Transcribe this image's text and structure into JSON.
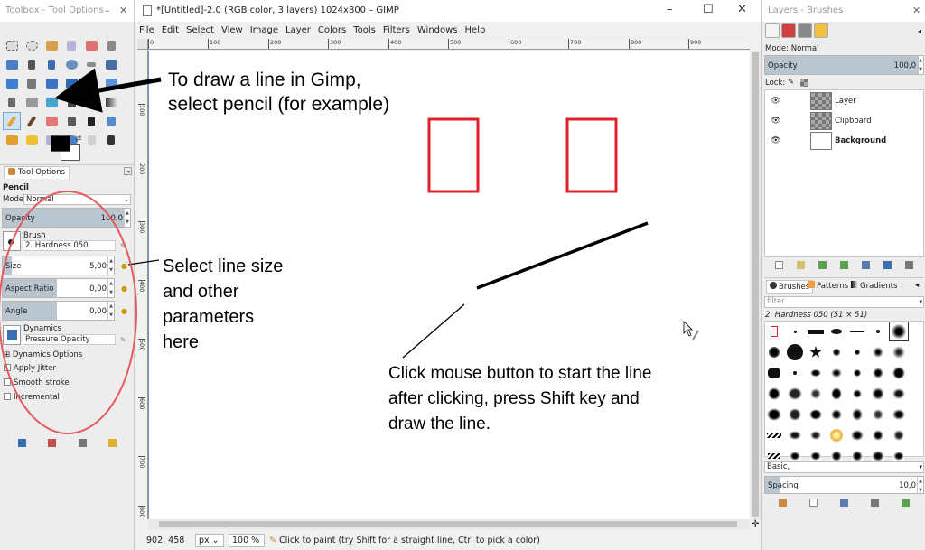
{
  "toolbox": {
    "title": "Toolbox - Tool Options",
    "tool_options_tab": "Tool Options",
    "tool_name": "Pencil",
    "mode_label": "Mode:",
    "mode_value": "Normal",
    "opacity_label": "Opacity",
    "opacity_value": "100,0",
    "brush_label": "Brush",
    "brush_value": "2. Hardness 050",
    "size_label": "Size",
    "size_value": "5,00",
    "aspect_label": "Aspect Ratio",
    "aspect_value": "0,00",
    "angle_label": "Angle",
    "angle_value": "0,00",
    "dynamics_label": "Dynamics",
    "dynamics_value": "Pressure Opacity",
    "dynamics_options": "Dynamics Options",
    "apply_jitter": "Apply Jitter",
    "smooth_stroke": "Smooth stroke",
    "incremental": "Incremental"
  },
  "image_window": {
    "title": "*[Untitled]-2.0 (RGB color, 3 layers) 1024x800 – GIMP",
    "menu": [
      "File",
      "Edit",
      "Select",
      "View",
      "Image",
      "Layer",
      "Colors",
      "Tools",
      "Filters",
      "Windows",
      "Help"
    ],
    "ruler_h": [
      "0",
      "100",
      "200",
      "300",
      "400",
      "500",
      "600",
      "700",
      "800",
      "900"
    ],
    "ruler_v": [
      "100",
      "200",
      "300",
      "400",
      "500",
      "600",
      "700",
      "800"
    ],
    "coords": "902, 458",
    "unit": "px",
    "zoom": "100 %",
    "status_message": "Click to paint (try Shift for a straight line, Ctrl to pick a color)"
  },
  "dock": {
    "title": "Layers - Brushes",
    "mode_label": "Mode: Normal",
    "opacity_label": "Opacity",
    "opacity_value": "100,0",
    "lock_label": "Lock:",
    "layers": [
      "Layer",
      "Clipboard",
      "Background"
    ],
    "brush_tabs": [
      "Brushes",
      "Patterns",
      "Gradients"
    ],
    "filter_placeholder": "filter",
    "selected_brush": "2. Hardness 050 (51 × 51)",
    "preset": "Basic,",
    "spacing_label": "Spacing",
    "spacing_value": "10,0"
  },
  "annotations": {
    "pencil_note": [
      "To draw a line in Gimp,",
      "select pencil (for example)"
    ],
    "size_note": [
      "Select line size",
      "and other",
      "parameters",
      "here"
    ],
    "click_note": [
      "Click mouse button to start the line",
      "after clicking, press Shift key and",
      "draw the line."
    ]
  },
  "colors": {
    "highlight_red": "#e0202a",
    "slider_fill": "#b9c5cf",
    "active_blue": "#7aa7d6"
  }
}
